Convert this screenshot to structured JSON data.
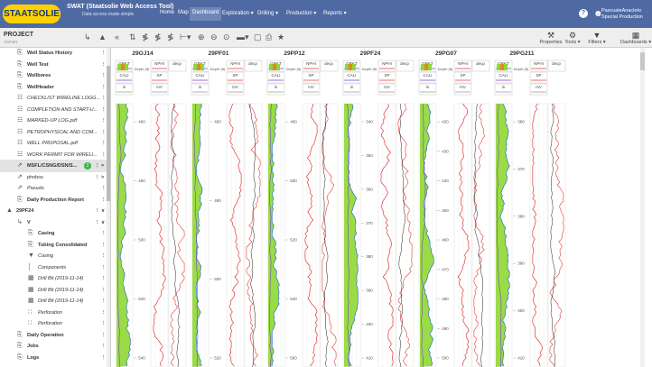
{
  "brand": {
    "logo": "STAATSOLIE",
    "title": "SWAT (Staatsolie Web Access Tool)",
    "subtitle": "Data access made simple"
  },
  "nav": {
    "items": [
      {
        "label": "Home",
        "active": false
      },
      {
        "label": "Map",
        "active": false
      },
      {
        "label": "Dashboard",
        "active": true
      },
      {
        "label": "Exploration ▾",
        "active": false
      },
      {
        "label": "Drilling ▾",
        "active": false
      },
      {
        "label": "Production ▾",
        "active": false
      },
      {
        "label": "Reports ▾",
        "active": false
      }
    ]
  },
  "user": {
    "name": "PascualeAnacleto",
    "role": "Special Production",
    "help": "?"
  },
  "toolbar": {
    "project": "PROJECT",
    "project_sub": "TOPSET",
    "right": [
      {
        "label": "Properties",
        "icon": "wrench-icon"
      },
      {
        "label": "Tools ▾",
        "icon": "tools-icon"
      },
      {
        "label": "Filters ▾",
        "icon": "filter-icon"
      },
      {
        "label": "Dashboards ▾",
        "icon": "grid-icon"
      }
    ]
  },
  "sidebar": {
    "items": [
      {
        "label": "Well Status History",
        "icon": "report-icon",
        "bold": true,
        "menu": "⋮"
      },
      {
        "label": "Well Test",
        "icon": "report-icon",
        "bold": true,
        "menu": "⋮"
      },
      {
        "label": "Wellbores",
        "icon": "report-icon",
        "bold": true,
        "menu": "⋮"
      },
      {
        "label": "WellHeader",
        "icon": "report-icon",
        "bold": true,
        "menu": "⋮"
      },
      {
        "label": "CHECKLIST WIRELINE LOGG...",
        "icon": "document-icon",
        "italic": true,
        "menu": "⋮"
      },
      {
        "label": "COMPLETION AND START-U...",
        "icon": "document-icon",
        "italic": true,
        "menu": "⋮"
      },
      {
        "label": "MARKED-UP LOG.pdf",
        "icon": "document-icon",
        "italic": true,
        "menu": "⋮"
      },
      {
        "label": "PETROPHYSICAL AND COM...",
        "icon": "document-icon",
        "italic": true,
        "menu": "⋮"
      },
      {
        "label": "WELL PROPOSAL.pdf",
        "icon": "document-icon",
        "italic": true,
        "menu": "⋮"
      },
      {
        "label": "WORK PERMIT FOR WIRELI...",
        "icon": "document-icon",
        "italic": true,
        "menu": "⋮"
      },
      {
        "label": "MSFL/CSNG/DSN/S...",
        "icon": "link-icon",
        "bold": true,
        "menu": "⋮ >",
        "badge": "2",
        "selected": true
      },
      {
        "label": "phobos",
        "icon": "link-icon",
        "menu": "⋮ >"
      },
      {
        "label": "Pseudo",
        "icon": "link-icon",
        "italic": true,
        "menu": "⋮"
      },
      {
        "label": "Daily Production Report",
        "icon": "report-icon",
        "bold": true,
        "menu": "⋮"
      },
      {
        "label": "29PF24",
        "icon": "well-icon",
        "bold": true,
        "menu": "⋮ ∨",
        "indent": 0
      },
      {
        "label": "V",
        "icon": "wellbore-icon",
        "bold": true,
        "menu": "⋮ ∨",
        "indent": 1
      },
      {
        "label": "Casing",
        "icon": "report-icon",
        "bold": true,
        "menu": "⋮",
        "indent": 2
      },
      {
        "label": "Tubing Consolidated",
        "icon": "report-icon",
        "bold": true,
        "menu": "⋮",
        "indent": 2
      },
      {
        "label": "Casing",
        "icon": "casing-icon",
        "italic": true,
        "menu": "⋮",
        "indent": 2
      },
      {
        "label": "Components",
        "icon": "component-icon",
        "italic": true,
        "menu": "⋮",
        "indent": 2
      },
      {
        "label": "Drill Bit (2019-11-14)",
        "icon": "drill-icon",
        "italic": true,
        "menu": "⋮",
        "indent": 2
      },
      {
        "label": "Drill Bit (2019-11-14)",
        "icon": "drill-icon",
        "italic": true,
        "menu": "⋮",
        "indent": 2
      },
      {
        "label": "Drill Bit (2019-11-14)",
        "icon": "drill-icon",
        "italic": true,
        "menu": "⋮",
        "indent": 2
      },
      {
        "label": "Perforation",
        "icon": "perforation-icon",
        "italic": true,
        "menu": "⋮",
        "indent": 2
      },
      {
        "label": "Perforation",
        "icon": "perforation-icon",
        "italic": true,
        "menu": "⋮",
        "indent": 2
      },
      {
        "label": "Daily Operation",
        "icon": "report-icon",
        "bold": true,
        "menu": "⋮",
        "indent": 1
      },
      {
        "label": "Jobs",
        "icon": "report-icon",
        "bold": true,
        "menu": "⋮",
        "indent": 1
      },
      {
        "label": "Logs",
        "icon": "report-icon",
        "bold": true,
        "menu": "⋮",
        "indent": 1
      }
    ]
  },
  "panel": {
    "curve_headers": [
      [
        "GRKT",
        "NPHI"
      ],
      [
        "CALI",
        "SP"
      ],
      [
        "in",
        "mV"
      ]
    ],
    "depth_label": "Depth (ft)",
    "res_label": "decp",
    "colors": {
      "gr": "#2f6fc6",
      "fill": "#8fd832",
      "caliper": "#7d3fbf",
      "sp": "#e23b3b",
      "res": "#222222"
    },
    "wells": [
      {
        "name": "29OJ14",
        "ticks": [
          "460",
          "480",
          "500",
          "520",
          "540"
        ]
      },
      {
        "name": "29PF01",
        "ticks": [
          "460",
          "480",
          "500",
          "520"
        ]
      },
      {
        "name": "29PP12",
        "ticks": [
          "480",
          "500",
          "520",
          "540",
          "560"
        ]
      },
      {
        "name": "29PF24",
        "ticks": [
          "340",
          "350",
          "360",
          "370",
          "380",
          "390",
          "400",
          "410"
        ]
      },
      {
        "name": "29PG07",
        "ticks": [
          "420",
          "430",
          "440",
          "450",
          "460",
          "470",
          "480",
          "490",
          "500"
        ]
      },
      {
        "name": "29PG211",
        "ticks": [
          "380",
          "370",
          "380",
          "390",
          "400",
          "410"
        ]
      }
    ]
  }
}
